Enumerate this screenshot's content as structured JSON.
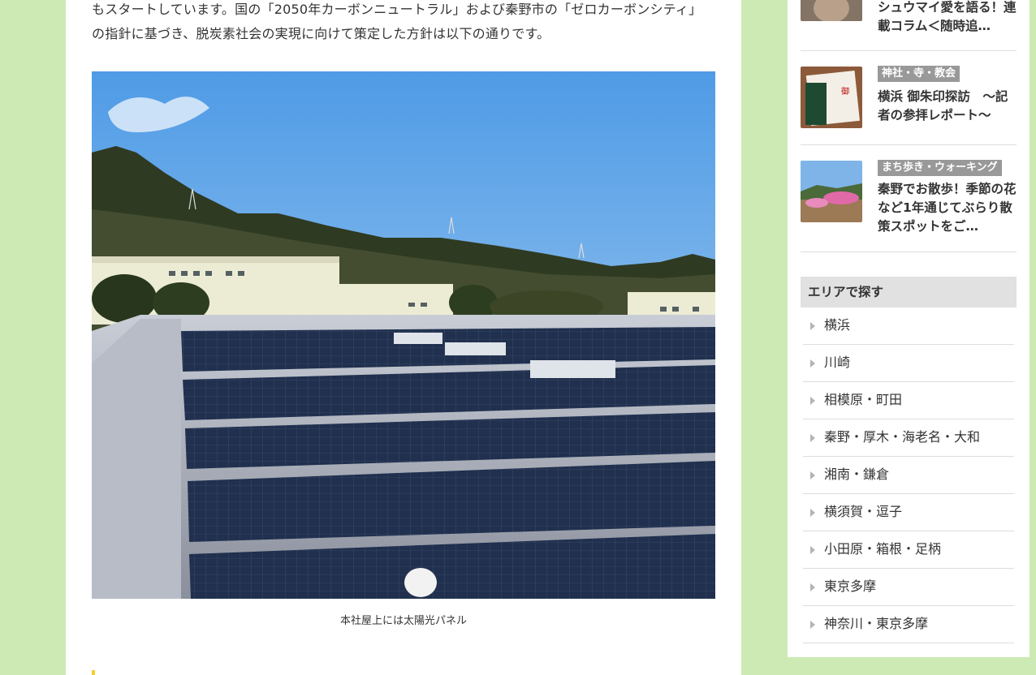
{
  "article": {
    "paragraph_lines": [
      "もスタートしています。国の「2050年カーボンニュートラル」および秦野市の「ゼロカーボンシティ」",
      "の指針に基づき、脱炭素社会の実現に向けて策定した方針は以下の通りです。"
    ],
    "photo_caption": "本社屋上には太陽光パネル"
  },
  "sidebar": {
    "posts": [
      {
        "category": "",
        "title": "シュウマイ愛を語る！連載コラム＜随時追…"
      },
      {
        "category": "神社・寺・教会",
        "title": "横浜 御朱印探訪　～記者の参拝レポート～"
      },
      {
        "category": "まち歩き・ウォーキング",
        "title": "秦野でお散歩！季節の花など1年通じてぶらり散策スポットをご…"
      }
    ],
    "area_heading": "エリアで探す",
    "areas": [
      "横浜",
      "川崎",
      "相模原・町田",
      "秦野・厚木・海老名・大和",
      "湘南・鎌倉",
      "横須賀・逗子",
      "小田原・箱根・足柄",
      "東京多摩",
      "神奈川・東京多摩"
    ]
  },
  "colors": {
    "page_background": "#cdeab5",
    "category_badge": "#999999",
    "heading_accent": "#f2cf2b",
    "area_heading_bg": "#e1e1e1"
  },
  "icons": {
    "area_bullet": "triangle-right-icon"
  }
}
